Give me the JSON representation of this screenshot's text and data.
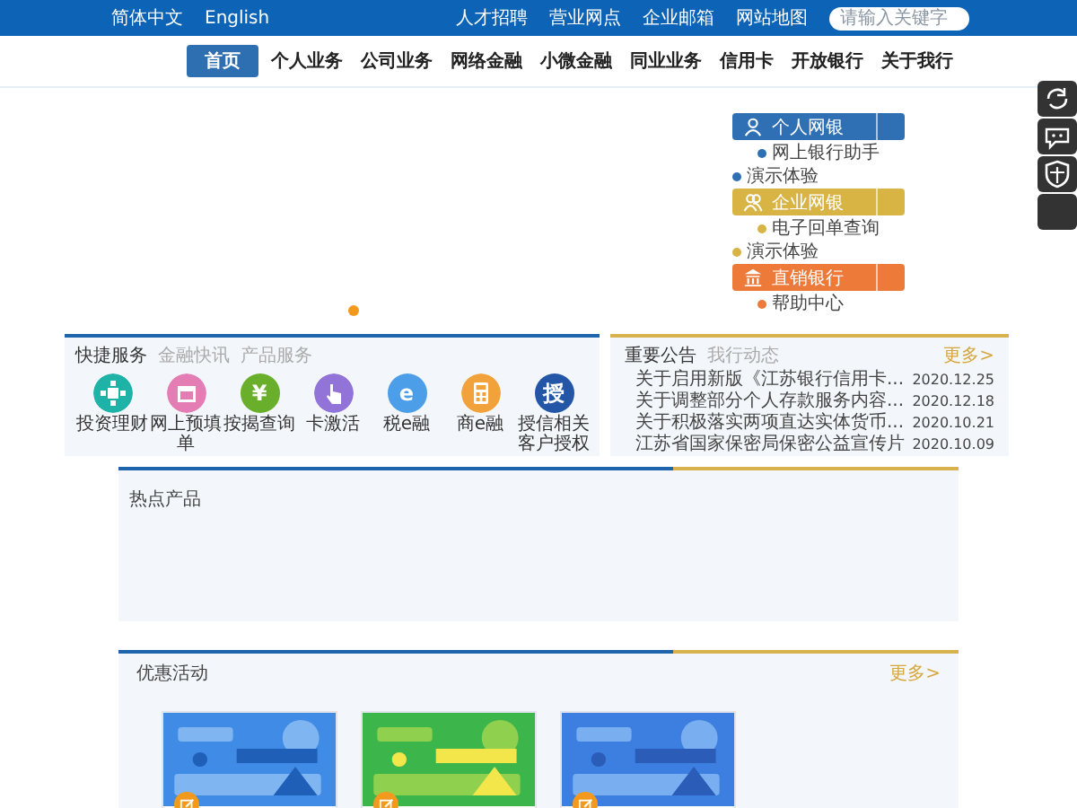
{
  "top_bar": {
    "languages": [
      "简体中文",
      "English"
    ],
    "links": [
      "人才招聘",
      "营业网点",
      "企业邮箱",
      "网站地图"
    ],
    "search": {
      "placeholder": "请输入关键字"
    }
  },
  "nav": [
    {
      "label": "首页",
      "selected": true
    },
    {
      "label": "个人业务",
      "selected": false
    },
    {
      "label": "公司业务",
      "selected": false
    },
    {
      "label": "网络金融",
      "selected": false
    },
    {
      "label": "小微金融",
      "selected": false
    },
    {
      "label": "同业业务",
      "selected": false
    },
    {
      "label": "信用卡",
      "selected": false
    },
    {
      "label": "开放银行",
      "selected": false
    },
    {
      "label": "关于我行",
      "selected": false
    }
  ],
  "login_panel": [
    {
      "button": "个人网银",
      "kind": "person",
      "color": "#2f6fb3",
      "items": [
        {
          "label": "网上银行助手",
          "indent": true
        },
        {
          "label": "演示体验",
          "indent": false
        }
      ]
    },
    {
      "button": "企业网银",
      "kind": "people",
      "color": "#d8b445",
      "items": [
        {
          "label": "电子回单查询",
          "indent": true
        },
        {
          "label": "演示体验",
          "indent": false
        }
      ]
    },
    {
      "button": "直销银行",
      "kind": "bank",
      "color": "#ee7a3a",
      "items": [
        {
          "label": "帮助中心",
          "indent": true
        }
      ]
    }
  ],
  "quick_services": {
    "tabs": [
      {
        "label": "快捷服务",
        "selected": true
      },
      {
        "label": "金融快讯",
        "selected": false
      },
      {
        "label": "产品服务",
        "selected": false
      }
    ],
    "items": [
      {
        "label": "投资理财",
        "kind": "grid",
        "color": "#1fb2a6"
      },
      {
        "label": "网上预填单",
        "kind": "calendar",
        "color": "#e57db5"
      },
      {
        "label": "按揭查询",
        "kind": "glyph",
        "glyph": "¥",
        "color": "#6aaf2c"
      },
      {
        "label": "卡激活",
        "kind": "hand",
        "color": "#9273d8"
      },
      {
        "label": "税e融",
        "kind": "glyph",
        "glyph": "e",
        "color": "#4d9ee8"
      },
      {
        "label": "商e融",
        "kind": "calc",
        "color": "#f2a23a"
      },
      {
        "label": "授信相关客户授权",
        "kind": "glyph",
        "glyph": "授",
        "color": "#2456a8"
      }
    ]
  },
  "notices": {
    "tabs": [
      {
        "label": "重要公告",
        "selected": true
      },
      {
        "label": "我行动态",
        "selected": false
      }
    ],
    "more": "更多>",
    "rows": [
      {
        "title": "关于启用新版《江苏银行信用卡...",
        "date": "2020.12.25"
      },
      {
        "title": "关于调整部分个人存款服务内容...",
        "date": "2020.12.18"
      },
      {
        "title": "关于积极落实两项直达实体货币...",
        "date": "2020.10.21"
      },
      {
        "title": "江苏省国家保密局保密公益宣传片",
        "date": "2020.10.09"
      }
    ]
  },
  "hot_products": {
    "title": "热点产品"
  },
  "promotions": {
    "title": "优惠活动",
    "more": "更多>"
  }
}
